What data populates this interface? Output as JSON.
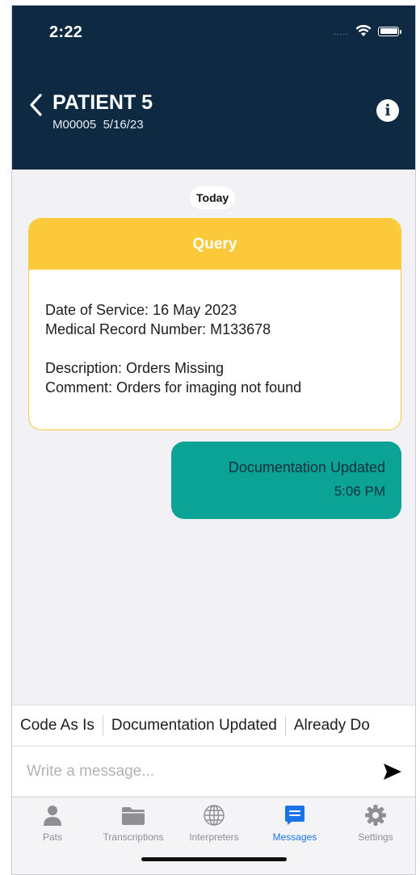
{
  "status": {
    "time": "2:22",
    "signal_dots": "....."
  },
  "header": {
    "patient_name": "PATIENT 5",
    "patient_id": "M00005",
    "date": "5/16/23"
  },
  "day_divider": "Today",
  "query_card": {
    "title": "Query",
    "date_of_service": "Date of Service: 16 May 2023",
    "mrn": "Medical Record Number: M133678",
    "description": "Description: Orders Missing",
    "comment": "Comment: Orders for imaging not found"
  },
  "reply": {
    "text": "Documentation Updated",
    "time": "5:06 PM"
  },
  "quick_replies": [
    "Code As Is",
    "Documentation Updated",
    "Already Do"
  ],
  "compose": {
    "placeholder": "Write a message..."
  },
  "tabs": [
    {
      "label": "Pats",
      "icon": "person-icon"
    },
    {
      "label": "Transcriptions",
      "icon": "folder-icon"
    },
    {
      "label": "Interpreters",
      "icon": "globe-icon"
    },
    {
      "label": "Messages",
      "icon": "message-icon",
      "active": true
    },
    {
      "label": "Settings",
      "icon": "gear-icon"
    }
  ],
  "colors": {
    "header": "#0e2a42",
    "query_accent": "#fcc93a",
    "reply_bubble": "#0aa396",
    "active_tab": "#1a73e8"
  }
}
